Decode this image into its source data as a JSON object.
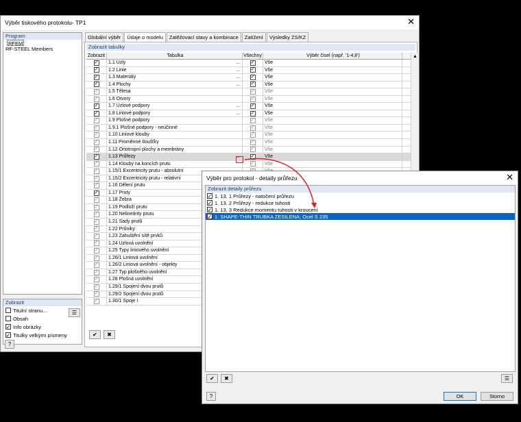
{
  "main": {
    "title": "Výběr tiskového protokolu- TP1",
    "program_header": "Program",
    "programs": [
      "RFEM",
      "RF-STEEL Members"
    ],
    "show_header": "Zobrazit",
    "show_options": [
      {
        "label": "Titulní stranu...",
        "checked": false
      },
      {
        "label": "Obsah",
        "checked": false
      },
      {
        "label": "Info obrázky",
        "checked": true
      },
      {
        "label": "Titulky velkými písmeny",
        "checked": true
      }
    ],
    "tabs": [
      "Globální výběr",
      "Údaje o modelu",
      "Zatěžovací stavy a kombinace",
      "Zatížení",
      "Výsledky ZS/KZ"
    ],
    "active_tab": 1,
    "table_section": "Zobrazit tabulky",
    "columns": [
      "Zobrazit",
      "Tabulka",
      "Všechny",
      "Výběr čísel (např. '1-4,8')"
    ],
    "rows": [
      {
        "name": "1.1 Uzly",
        "show": true,
        "all": true,
        "sel": "Vše",
        "dots": true
      },
      {
        "name": "1.2 Linie",
        "show": true,
        "all": true,
        "sel": "Vše",
        "dots": true
      },
      {
        "name": "1.3 Materiály",
        "show": true,
        "all": true,
        "sel": "Vše",
        "dots": true
      },
      {
        "name": "1.4 Plochy",
        "show": true,
        "all": true,
        "sel": "Vše",
        "dots": true
      },
      {
        "name": "1.5 Tělesa",
        "show": false,
        "all": true,
        "sel": "Vše",
        "dots": false
      },
      {
        "name": "1.6 Otvory",
        "show": false,
        "all": true,
        "sel": "Vše",
        "dots": false
      },
      {
        "name": "1.7 Uzlové podpory",
        "show": true,
        "all": true,
        "sel": "Vše",
        "dots": true
      },
      {
        "name": "1.8 Liniové podpory",
        "show": true,
        "all": true,
        "sel": "Vše",
        "dots": true
      },
      {
        "name": "1.9 Plošné podpory",
        "show": false,
        "all": true,
        "sel": "Vše",
        "dots": false
      },
      {
        "name": "1.9.1 Plošné podpory - neúčinné",
        "show": false,
        "all": true,
        "sel": "Vše",
        "dots": false
      },
      {
        "name": "1.10 Liniové klouby",
        "show": false,
        "all": true,
        "sel": "Vše",
        "dots": false
      },
      {
        "name": "1.11 Proměnné tloušťky",
        "show": false,
        "all": true,
        "sel": "Vše",
        "dots": false
      },
      {
        "name": "1.12 Ortotropní plochy a membrány",
        "show": false,
        "all": true,
        "sel": "Vše",
        "dots": false
      },
      {
        "name": "1.13 Průřezy",
        "show": true,
        "all": true,
        "sel": "Vše",
        "dots": true,
        "hl": true
      },
      {
        "name": "1.14 Klouby na koncích prutu",
        "show": false,
        "all": true,
        "sel": "Vše",
        "dots": false
      },
      {
        "name": "1.15/1 Excentricity prutu - absolutní",
        "show": false,
        "all": true,
        "sel": "Vše",
        "dots": false
      },
      {
        "name": "1.15/2 Excentricity prutu - relativní",
        "show": false,
        "all": true,
        "sel": "Vše",
        "dots": false
      },
      {
        "name": "1.16 Dělení prutu",
        "show": false,
        "all": true,
        "sel": "Vše",
        "dots": false
      },
      {
        "name": "1.17 Pruty",
        "show": true,
        "all": true,
        "sel": "Vše",
        "dots": false
      },
      {
        "name": "1.18 Žebra",
        "show": false,
        "all": true,
        "sel": "Vše",
        "dots": false
      },
      {
        "name": "1.19 Podloží prutu",
        "show": false,
        "all": true,
        "sel": "Vše",
        "dots": false
      },
      {
        "name": "1.20 Nelineárity prutu",
        "show": false,
        "all": true,
        "sel": "Vše",
        "dots": false
      },
      {
        "name": "1.21 Sady prutů",
        "show": false,
        "all": true,
        "sel": "Vše",
        "dots": false
      },
      {
        "name": "1.22 Průniky",
        "show": false,
        "all": true,
        "sel": "Vše",
        "dots": false
      },
      {
        "name": "1.23 Zahuštění sítě prvků",
        "show": false,
        "all": true,
        "sel": "Vše",
        "dots": false
      },
      {
        "name": "1.24 Uzlová uvolnění",
        "show": false,
        "all": true,
        "sel": "Vše",
        "dots": false
      },
      {
        "name": "1.25 Typy liniového uvolnění",
        "show": false,
        "all": true,
        "sel": "Vše",
        "dots": false
      },
      {
        "name": "1.26/1 Liniová uvolnění",
        "show": false,
        "all": true,
        "sel": "Vše",
        "dots": false
      },
      {
        "name": "1.26/2 Liniová uvolnění - objekty",
        "show": false,
        "all": true,
        "sel": "Vše",
        "dots": false
      },
      {
        "name": "1.27 Typ plošného uvolnění",
        "show": false,
        "all": true,
        "sel": "Vše",
        "dots": false
      },
      {
        "name": "1.28 Plošná uvolnění",
        "show": false,
        "all": true,
        "sel": "Vše",
        "dots": false
      },
      {
        "name": "1.29/1 Spojení dvou prutů",
        "show": false,
        "all": true,
        "sel": "Vše",
        "dots": false
      },
      {
        "name": "1.29/2 Spojení dvou prutů",
        "show": false,
        "all": true,
        "sel": "Vše",
        "dots": false
      },
      {
        "name": "1.30/1 Spoje I",
        "show": false,
        "all": true,
        "sel": "Vše",
        "dots": false
      }
    ]
  },
  "detail": {
    "title": "Výběr pro protokol - detaily průřezu",
    "section": "Zobrazit detaily průřezu",
    "items": [
      {
        "label": "1. 13. 1 Průřezy - natočení průřezu",
        "checked": true,
        "selected": false
      },
      {
        "label": "1. 13. 2 Průřezy - redukce tuhosti",
        "checked": true,
        "selected": false
      },
      {
        "label": "1. 13. 3 Redukce momentu tuhosti v kroucení",
        "checked": true,
        "selected": false
      },
      {
        "label": "1: SHAPE-THIN TRUBKA ZESILENA; Ocel S 235",
        "checked": true,
        "selected": true
      }
    ],
    "ok": "OK",
    "cancel": "Storno"
  },
  "colors": {
    "accent": "#0a64c8",
    "section_bg": "#dde7f3",
    "highlight": "#e02020"
  }
}
